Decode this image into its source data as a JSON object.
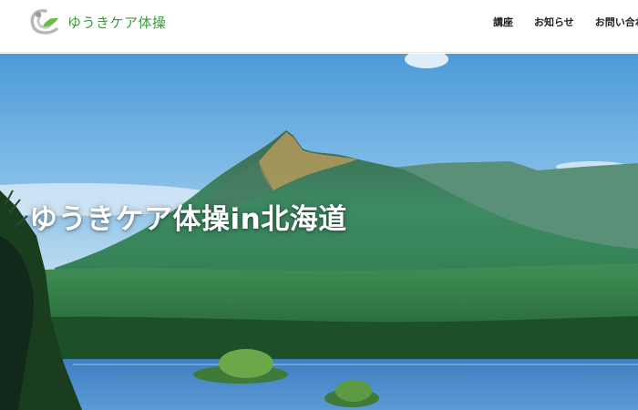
{
  "header": {
    "logo_text": "ゆうきケア体操",
    "nav": [
      {
        "label": "講座"
      },
      {
        "label": "お知らせ"
      },
      {
        "label": "お問い合わ"
      }
    ]
  },
  "hero": {
    "title": "ゆうきケア体操in北海道"
  },
  "colors": {
    "brand_green": "#3c9a3c",
    "nav_text": "#222222",
    "hero_title": "#ffffff"
  },
  "icons": {
    "logo": "logo-mark-icon"
  }
}
